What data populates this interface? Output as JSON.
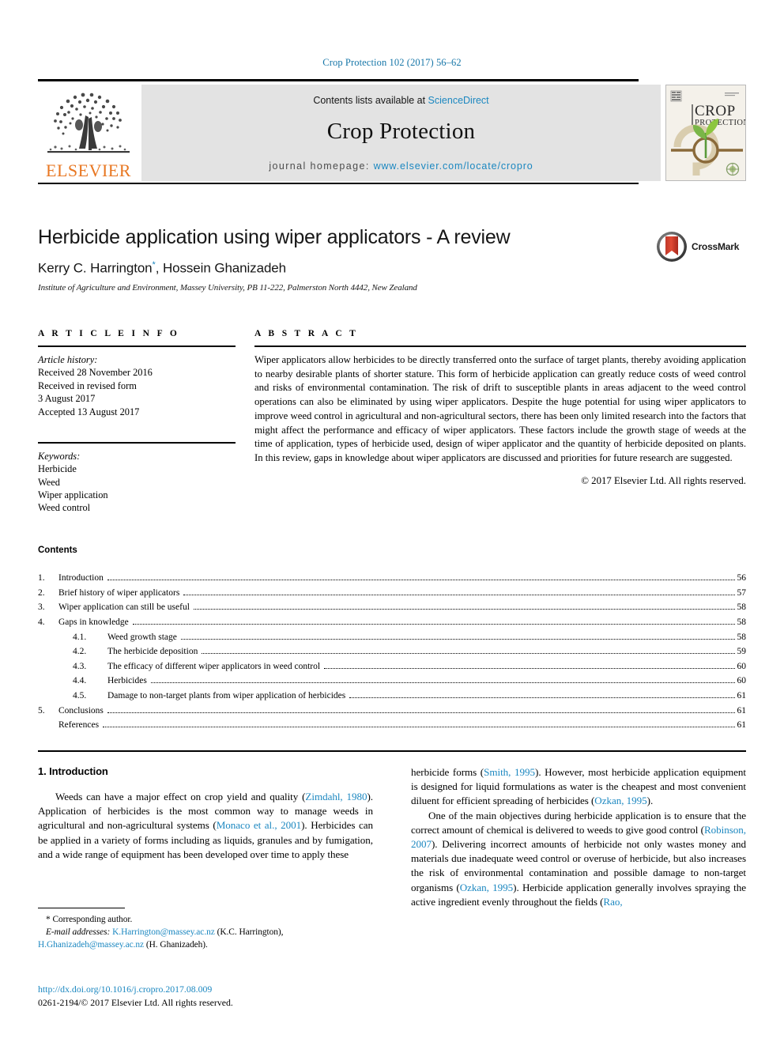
{
  "running_head": "Crop Protection 102 (2017) 56–62",
  "masthead": {
    "publisher_name": "ELSEVIER",
    "contents_prefix": "Contents lists available at ",
    "contents_link": "ScienceDirect",
    "journal_title": "Crop Protection",
    "homepage_prefix": "journal homepage: ",
    "homepage_url": "www.elsevier.com/locate/cropro",
    "cover_title_line1": "CROP",
    "cover_title_line2": "PROTECTION"
  },
  "article": {
    "title": "Herbicide application using wiper applicators - A review",
    "authors": "Kerry C. Harrington",
    "authors_marker": "*",
    "authors_rest": ", Hossein Ghanizadeh",
    "affiliation": "Institute of Agriculture and Environment, Massey University, PB 11-222, Palmerston North 4442, New Zealand",
    "crossmark_label": "CrossMark"
  },
  "article_info": {
    "heading": "A R T I C L E   I N F O",
    "history_title": "Article history:",
    "history_lines": [
      "Received 28 November 2016",
      "Received in revised form",
      "3 August 2017",
      "Accepted 13 August 2017"
    ],
    "keywords_title": "Keywords:",
    "keywords": [
      "Herbicide",
      "Weed",
      "Wiper application",
      "Weed control"
    ]
  },
  "abstract": {
    "heading": "A B S T R A C T",
    "text": "Wiper applicators allow herbicides to be directly transferred onto the surface of target plants, thereby avoiding application to nearby desirable plants of shorter stature. This form of herbicide application can greatly reduce costs of weed control and risks of environmental contamination. The risk of drift to susceptible plants in areas adjacent to the weed control operations can also be eliminated by using wiper applicators. Despite the huge potential for using wiper applicators to improve weed control in agricultural and non-agricultural sectors, there has been only limited research into the factors that might affect the performance and efficacy of wiper applicators. These factors include the growth stage of weeds at the time of application, types of herbicide used, design of wiper applicator and the quantity of herbicide deposited on plants. In this review, gaps in knowledge about wiper applicators are discussed and priorities for future research are suggested.",
    "copyright": "© 2017 Elsevier Ltd. All rights reserved."
  },
  "contents": {
    "label": "Contents",
    "entries": [
      {
        "num": "1.",
        "label": "Introduction",
        "page": "56",
        "sub": false
      },
      {
        "num": "2.",
        "label": "Brief history of wiper applicators",
        "page": "57",
        "sub": false
      },
      {
        "num": "3.",
        "label": "Wiper application can still be useful",
        "page": "58",
        "sub": false
      },
      {
        "num": "4.",
        "label": "Gaps in knowledge",
        "page": "58",
        "sub": false
      },
      {
        "num": "4.1.",
        "label": "Weed growth stage",
        "page": "58",
        "sub": true
      },
      {
        "num": "4.2.",
        "label": "The herbicide deposition",
        "page": "59",
        "sub": true
      },
      {
        "num": "4.3.",
        "label": "The efficacy of different wiper applicators in weed control",
        "page": "60",
        "sub": true
      },
      {
        "num": "4.4.",
        "label": "Herbicides",
        "page": "60",
        "sub": true
      },
      {
        "num": "4.5.",
        "label": "Damage to non-target plants from wiper application of herbicides",
        "page": "61",
        "sub": true
      },
      {
        "num": "5.",
        "label": "Conclusions",
        "page": "61",
        "sub": false
      },
      {
        "num": "",
        "label": "References",
        "page": "61",
        "sub": false
      }
    ]
  },
  "body": {
    "section_heading": "1.  Introduction",
    "left_p1_a": "Weeds can have a major effect on crop yield and quality (",
    "left_p1_ref1": "Zimdahl, 1980",
    "left_p1_b": "). Application of herbicides is the most common way to manage weeds in agricultural and non-agricultural systems (",
    "left_p1_ref2": "Monaco et al., 2001",
    "left_p1_c": "). Herbicides can be applied in a variety of forms including as liquids, granules and by fumigation, and a wide range of equipment has been developed over time to apply these",
    "right_p1_a": "herbicide forms (",
    "right_p1_ref1": "Smith, 1995",
    "right_p1_b": "). However, most herbicide application equipment is designed for liquid formulations as water is the cheapest and most convenient diluent for efficient spreading of herbicides (",
    "right_p1_ref2": "Ozkan, 1995",
    "right_p1_c": ").",
    "right_p2_a": "One of the main objectives during herbicide application is to ensure that the correct amount of chemical is delivered to weeds to give good control (",
    "right_p2_ref1": "Robinson, 2007",
    "right_p2_b": "). Delivering incorrect amounts of herbicide not only wastes money and materials due inadequate weed control or overuse of herbicide, but also increases the risk of environmental contamination and possible damage to non-target organisms (",
    "right_p2_ref2": "Ozkan, 1995",
    "right_p2_c": "). Herbicide application generally involves spraying the active ingredient evenly throughout the fields (",
    "right_p2_ref3": "Rao,"
  },
  "footnote": {
    "corresponding": "* Corresponding author.",
    "email_label": "E-mail addresses:",
    "email1": "K.Harrington@massey.ac.nz",
    "email1_name": "(K.C. Harrington),",
    "email2_part1": "H.Ghanizadeh@",
    "email2_part2": "massey.ac.nz",
    "email2_name": "(H. Ghanizadeh)."
  },
  "footer": {
    "doi": "http://dx.doi.org/10.1016/j.cropro.2017.08.009",
    "issn": "0261-2194/© 2017 Elsevier Ltd. All rights reserved."
  },
  "colors": {
    "link": "#1b87c0",
    "running_head": "#1676a8",
    "elsevier_orange": "#e87722",
    "band_gray": "#e3e3e3"
  }
}
